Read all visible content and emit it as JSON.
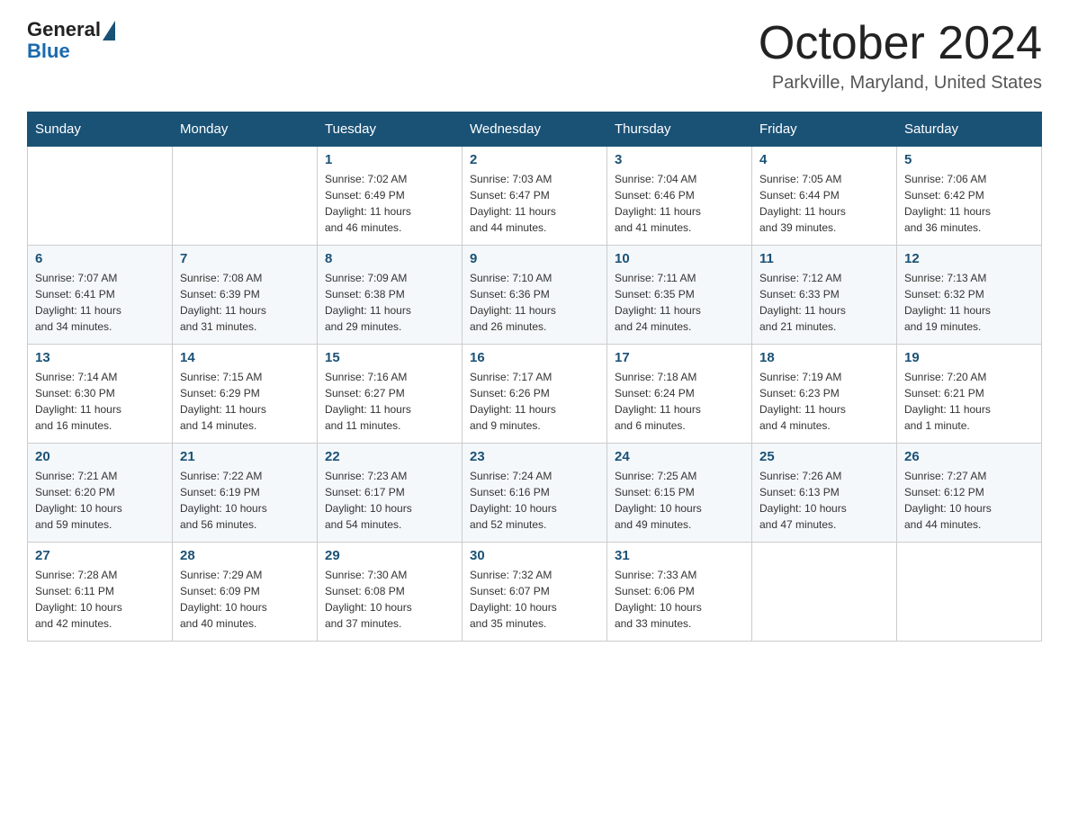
{
  "header": {
    "logo_general": "General",
    "logo_blue": "Blue",
    "title": "October 2024",
    "location": "Parkville, Maryland, United States"
  },
  "weekdays": [
    "Sunday",
    "Monday",
    "Tuesday",
    "Wednesday",
    "Thursday",
    "Friday",
    "Saturday"
  ],
  "weeks": [
    [
      {
        "day": "",
        "info": ""
      },
      {
        "day": "",
        "info": ""
      },
      {
        "day": "1",
        "info": "Sunrise: 7:02 AM\nSunset: 6:49 PM\nDaylight: 11 hours\nand 46 minutes."
      },
      {
        "day": "2",
        "info": "Sunrise: 7:03 AM\nSunset: 6:47 PM\nDaylight: 11 hours\nand 44 minutes."
      },
      {
        "day": "3",
        "info": "Sunrise: 7:04 AM\nSunset: 6:46 PM\nDaylight: 11 hours\nand 41 minutes."
      },
      {
        "day": "4",
        "info": "Sunrise: 7:05 AM\nSunset: 6:44 PM\nDaylight: 11 hours\nand 39 minutes."
      },
      {
        "day": "5",
        "info": "Sunrise: 7:06 AM\nSunset: 6:42 PM\nDaylight: 11 hours\nand 36 minutes."
      }
    ],
    [
      {
        "day": "6",
        "info": "Sunrise: 7:07 AM\nSunset: 6:41 PM\nDaylight: 11 hours\nand 34 minutes."
      },
      {
        "day": "7",
        "info": "Sunrise: 7:08 AM\nSunset: 6:39 PM\nDaylight: 11 hours\nand 31 minutes."
      },
      {
        "day": "8",
        "info": "Sunrise: 7:09 AM\nSunset: 6:38 PM\nDaylight: 11 hours\nand 29 minutes."
      },
      {
        "day": "9",
        "info": "Sunrise: 7:10 AM\nSunset: 6:36 PM\nDaylight: 11 hours\nand 26 minutes."
      },
      {
        "day": "10",
        "info": "Sunrise: 7:11 AM\nSunset: 6:35 PM\nDaylight: 11 hours\nand 24 minutes."
      },
      {
        "day": "11",
        "info": "Sunrise: 7:12 AM\nSunset: 6:33 PM\nDaylight: 11 hours\nand 21 minutes."
      },
      {
        "day": "12",
        "info": "Sunrise: 7:13 AM\nSunset: 6:32 PM\nDaylight: 11 hours\nand 19 minutes."
      }
    ],
    [
      {
        "day": "13",
        "info": "Sunrise: 7:14 AM\nSunset: 6:30 PM\nDaylight: 11 hours\nand 16 minutes."
      },
      {
        "day": "14",
        "info": "Sunrise: 7:15 AM\nSunset: 6:29 PM\nDaylight: 11 hours\nand 14 minutes."
      },
      {
        "day": "15",
        "info": "Sunrise: 7:16 AM\nSunset: 6:27 PM\nDaylight: 11 hours\nand 11 minutes."
      },
      {
        "day": "16",
        "info": "Sunrise: 7:17 AM\nSunset: 6:26 PM\nDaylight: 11 hours\nand 9 minutes."
      },
      {
        "day": "17",
        "info": "Sunrise: 7:18 AM\nSunset: 6:24 PM\nDaylight: 11 hours\nand 6 minutes."
      },
      {
        "day": "18",
        "info": "Sunrise: 7:19 AM\nSunset: 6:23 PM\nDaylight: 11 hours\nand 4 minutes."
      },
      {
        "day": "19",
        "info": "Sunrise: 7:20 AM\nSunset: 6:21 PM\nDaylight: 11 hours\nand 1 minute."
      }
    ],
    [
      {
        "day": "20",
        "info": "Sunrise: 7:21 AM\nSunset: 6:20 PM\nDaylight: 10 hours\nand 59 minutes."
      },
      {
        "day": "21",
        "info": "Sunrise: 7:22 AM\nSunset: 6:19 PM\nDaylight: 10 hours\nand 56 minutes."
      },
      {
        "day": "22",
        "info": "Sunrise: 7:23 AM\nSunset: 6:17 PM\nDaylight: 10 hours\nand 54 minutes."
      },
      {
        "day": "23",
        "info": "Sunrise: 7:24 AM\nSunset: 6:16 PM\nDaylight: 10 hours\nand 52 minutes."
      },
      {
        "day": "24",
        "info": "Sunrise: 7:25 AM\nSunset: 6:15 PM\nDaylight: 10 hours\nand 49 minutes."
      },
      {
        "day": "25",
        "info": "Sunrise: 7:26 AM\nSunset: 6:13 PM\nDaylight: 10 hours\nand 47 minutes."
      },
      {
        "day": "26",
        "info": "Sunrise: 7:27 AM\nSunset: 6:12 PM\nDaylight: 10 hours\nand 44 minutes."
      }
    ],
    [
      {
        "day": "27",
        "info": "Sunrise: 7:28 AM\nSunset: 6:11 PM\nDaylight: 10 hours\nand 42 minutes."
      },
      {
        "day": "28",
        "info": "Sunrise: 7:29 AM\nSunset: 6:09 PM\nDaylight: 10 hours\nand 40 minutes."
      },
      {
        "day": "29",
        "info": "Sunrise: 7:30 AM\nSunset: 6:08 PM\nDaylight: 10 hours\nand 37 minutes."
      },
      {
        "day": "30",
        "info": "Sunrise: 7:32 AM\nSunset: 6:07 PM\nDaylight: 10 hours\nand 35 minutes."
      },
      {
        "day": "31",
        "info": "Sunrise: 7:33 AM\nSunset: 6:06 PM\nDaylight: 10 hours\nand 33 minutes."
      },
      {
        "day": "",
        "info": ""
      },
      {
        "day": "",
        "info": ""
      }
    ]
  ]
}
